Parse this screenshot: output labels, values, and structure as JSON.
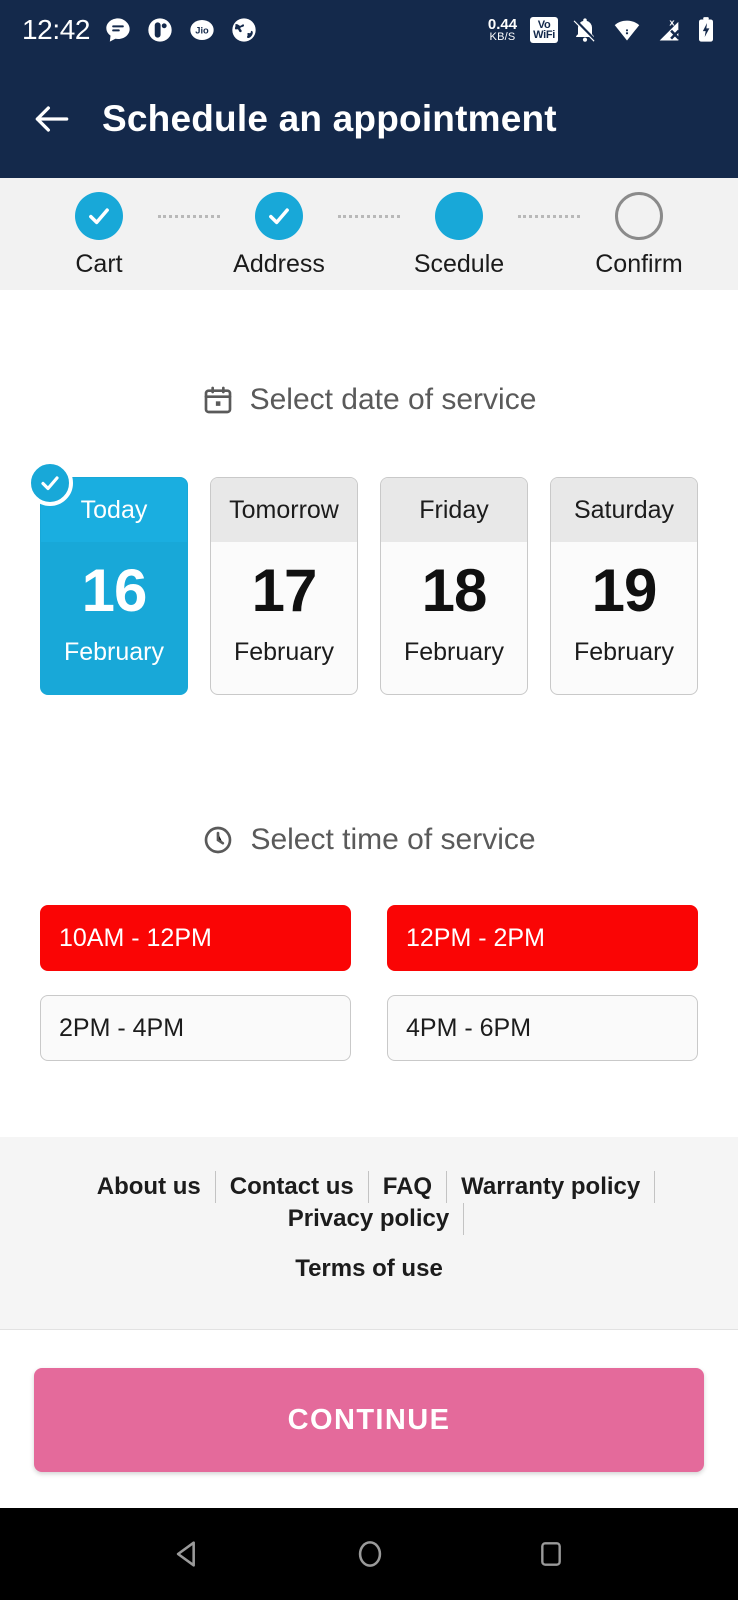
{
  "status_bar": {
    "time": "12:42",
    "app_icons": [
      "chat-icon",
      "camera-icon",
      "jio-icon",
      "globe-icon"
    ],
    "data_speed_value": "0.44",
    "data_speed_unit": "KB/S",
    "vowifi_line1": "Vo",
    "vowifi_line2": "WiFi",
    "right_icons": [
      "bell-muted-icon",
      "wifi-icon",
      "signal-no-sim-icon",
      "battery-charging-icon"
    ]
  },
  "app_bar": {
    "back_icon": "arrow-left-icon",
    "title": "Schedule an appointment"
  },
  "stepper": {
    "accent_color": "#18a8d8",
    "steps": [
      {
        "label": "Cart",
        "state": "done"
      },
      {
        "label": "Address",
        "state": "done"
      },
      {
        "label": "Scedule",
        "state": "active"
      },
      {
        "label": "Confirm",
        "state": "todo"
      }
    ]
  },
  "date_section": {
    "icon": "calendar-icon",
    "title": "Select date of service",
    "cards": [
      {
        "day": "Today",
        "date": "16",
        "month": "February",
        "selected": true
      },
      {
        "day": "Tomorrow",
        "date": "17",
        "month": "February",
        "selected": false
      },
      {
        "day": "Friday",
        "date": "18",
        "month": "February",
        "selected": false
      },
      {
        "day": "Saturday",
        "date": "19",
        "month": "February",
        "selected": false
      }
    ]
  },
  "time_section": {
    "icon": "clock-icon",
    "title": "Select time of service",
    "unavailable_color": "#fa0505",
    "slots": [
      {
        "label": "10AM - 12PM",
        "state": "unavailable"
      },
      {
        "label": "12PM - 2PM",
        "state": "unavailable"
      },
      {
        "label": "2PM - 4PM",
        "state": "available"
      },
      {
        "label": "4PM - 6PM",
        "state": "available"
      }
    ]
  },
  "footer": {
    "links_row1": [
      "About us",
      "Contact us",
      "FAQ",
      "Warranty policy",
      "Privacy policy"
    ],
    "links_row2": [
      "Terms of use"
    ]
  },
  "cta": {
    "label": "CONTINUE",
    "color": "#e46a9b"
  },
  "nav_bar": {
    "buttons": [
      "back-triangle-icon",
      "home-circle-icon",
      "recents-square-icon"
    ]
  }
}
